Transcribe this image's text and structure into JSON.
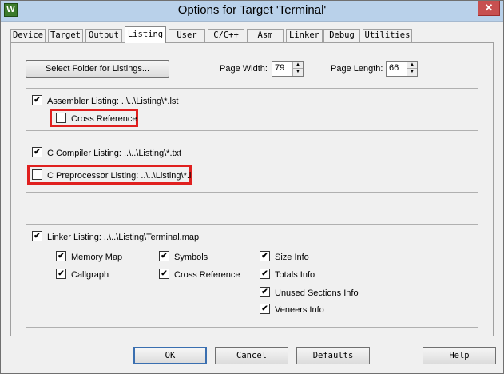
{
  "window": {
    "title": "Options for Target 'Terminal'",
    "icon_letter": "W",
    "close_glyph": "✕"
  },
  "tabs": [
    {
      "label": "Device"
    },
    {
      "label": "Target"
    },
    {
      "label": "Output"
    },
    {
      "label": "Listing",
      "active": true
    },
    {
      "label": "User"
    },
    {
      "label": "C/C++"
    },
    {
      "label": "Asm"
    },
    {
      "label": "Linker"
    },
    {
      "label": "Debug"
    },
    {
      "label": "Utilities"
    }
  ],
  "listing": {
    "select_folder_label": "Select Folder for Listings...",
    "page_width_label": "Page Width:",
    "page_width_value": "79",
    "page_length_label": "Page Length:",
    "page_length_value": "66",
    "assembler": {
      "label": "Assembler Listing:  ..\\..\\Listing\\*.lst",
      "checked": true,
      "cross_reference_label": "Cross Reference",
      "cross_reference_checked": false
    },
    "compiler": {
      "label": "C Compiler Listing:  ..\\..\\Listing\\*.txt",
      "checked": true,
      "preprocessor_label": "C Preprocessor Listing:  ..\\..\\Listing\\*.i",
      "preprocessor_checked": false
    },
    "linker": {
      "label": "Linker Listing:  ..\\..\\Listing\\Terminal.map",
      "checked": true,
      "options": {
        "memory_map": "Memory Map",
        "callgraph": "Callgraph",
        "symbols": "Symbols",
        "cross_reference": "Cross Reference",
        "size_info": "Size Info",
        "totals_info": "Totals Info",
        "unused_sections_info": "Unused Sections Info",
        "veneers_info": "Veneers Info"
      }
    },
    "check_glyph": "✔"
  },
  "buttons": {
    "ok": "OK",
    "cancel": "Cancel",
    "defaults": "Defaults",
    "help": "Help"
  },
  "colors": {
    "highlight": "#e0201f",
    "titlebar": "#b9d1ea",
    "close": "#c75050"
  },
  "spinner": {
    "up": "▲",
    "down": "▼"
  }
}
